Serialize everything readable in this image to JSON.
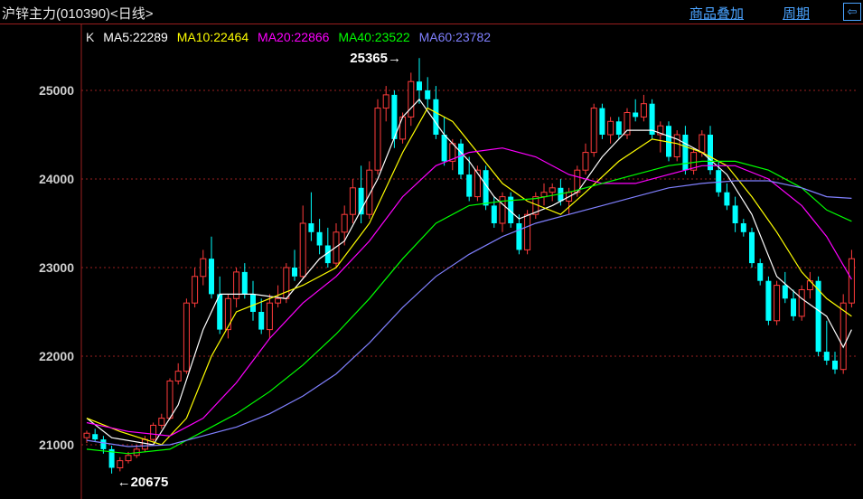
{
  "header": {
    "title": "沪锌主力(010390)<日线>",
    "overlay_link": "商品叠加",
    "period_link": "周期",
    "exit_icon": "exit-icon"
  },
  "colors": {
    "up": "#ff3b3b",
    "down": "#00ffff",
    "grid": "#9a1f1f",
    "axis_text": "#d0d0d0"
  },
  "legend": {
    "k_label": "K",
    "ma5": {
      "label": "MA5:22289",
      "color": "#ffffff"
    },
    "ma10": {
      "label": "MA10:22464",
      "color": "#ffff00"
    },
    "ma20": {
      "label": "MA20:22866",
      "color": "#ff00ff"
    },
    "ma40": {
      "label": "MA40:23522",
      "color": "#00ff00"
    },
    "ma60": {
      "label": "MA60:23782",
      "color": "#8080ff"
    }
  },
  "chart_data": {
    "type": "candlestick",
    "y_ticks": [
      "25000",
      "24000",
      "23000",
      "22000",
      "21000"
    ],
    "ylim": [
      20500,
      25500
    ],
    "grid": "horizontal dotted",
    "annotations": [
      {
        "text": "25365",
        "index": 40,
        "value": 25365,
        "side": "left"
      },
      {
        "text": "20675",
        "index": 3,
        "value": 20675,
        "side": "right"
      }
    ],
    "candles": [
      [
        21080,
        21160,
        21020,
        21130
      ],
      [
        21120,
        21180,
        21040,
        21060
      ],
      [
        21060,
        21100,
        20900,
        20950
      ],
      [
        20950,
        20990,
        20675,
        20740
      ],
      [
        20740,
        20860,
        20700,
        20820
      ],
      [
        20820,
        20920,
        20790,
        20880
      ],
      [
        20880,
        21000,
        20850,
        20950
      ],
      [
        20950,
        21100,
        20920,
        21060
      ],
      [
        21060,
        21250,
        21030,
        21220
      ],
      [
        21220,
        21350,
        21180,
        21300
      ],
      [
        21300,
        21750,
        21280,
        21720
      ],
      [
        21720,
        21920,
        21680,
        21830
      ],
      [
        21830,
        22650,
        21800,
        22600
      ],
      [
        22600,
        23000,
        22550,
        22900
      ],
      [
        22900,
        23200,
        22800,
        23100
      ],
      [
        23100,
        23350,
        22650,
        22700
      ],
      [
        22700,
        22900,
        22250,
        22300
      ],
      [
        22300,
        22700,
        22200,
        22650
      ],
      [
        22650,
        23000,
        22550,
        22950
      ],
      [
        22950,
        23050,
        22650,
        22700
      ],
      [
        22700,
        22850,
        22400,
        22500
      ],
      [
        22500,
        22650,
        22250,
        22300
      ],
      [
        22300,
        22700,
        22200,
        22600
      ],
      [
        22600,
        22800,
        22550,
        22650
      ],
      [
        22650,
        23050,
        22600,
        23000
      ],
      [
        23000,
        23200,
        22850,
        22900
      ],
      [
        22900,
        23700,
        22880,
        23500
      ],
      [
        23500,
        23850,
        23300,
        23400
      ],
      [
        23400,
        23550,
        23150,
        23250
      ],
      [
        23250,
        23450,
        23000,
        23050
      ],
      [
        23050,
        23500,
        23000,
        23400
      ],
      [
        23400,
        23700,
        23250,
        23600
      ],
      [
        23600,
        24000,
        23500,
        23900
      ],
      [
        23900,
        24150,
        23500,
        23600
      ],
      [
        23600,
        24200,
        23550,
        24100
      ],
      [
        24100,
        24900,
        24050,
        24800
      ],
      [
        24800,
        25050,
        24650,
        24950
      ],
      [
        24950,
        25000,
        24350,
        24450
      ],
      [
        24450,
        24750,
        24400,
        24700
      ],
      [
        24700,
        25200,
        24600,
        25100
      ],
      [
        25100,
        25365,
        24850,
        25000
      ],
      [
        25000,
        25150,
        24800,
        24900
      ],
      [
        24900,
        25050,
        24450,
        24500
      ],
      [
        24500,
        24700,
        24150,
        24200
      ],
      [
        24200,
        24450,
        24100,
        24400
      ],
      [
        24400,
        24450,
        24000,
        24050
      ],
      [
        24050,
        24250,
        23750,
        23800
      ],
      [
        23800,
        24150,
        23750,
        24100
      ],
      [
        24100,
        24150,
        23650,
        23700
      ],
      [
        23700,
        23800,
        23450,
        23500
      ],
      [
        23500,
        23850,
        23400,
        23800
      ],
      [
        23800,
        23850,
        23450,
        23500
      ],
      [
        23500,
        23600,
        23150,
        23200
      ],
      [
        23200,
        23650,
        23150,
        23600
      ],
      [
        23600,
        23850,
        23550,
        23800
      ],
      [
        23800,
        23950,
        23700,
        23850
      ],
      [
        23850,
        23950,
        23750,
        23900
      ],
      [
        23900,
        24000,
        23700,
        23750
      ],
      [
        23750,
        23900,
        23600,
        23850
      ],
      [
        23850,
        24150,
        23800,
        24100
      ],
      [
        24100,
        24400,
        24050,
        24300
      ],
      [
        24300,
        24850,
        24250,
        24800
      ],
      [
        24800,
        24850,
        24450,
        24500
      ],
      [
        24500,
        24700,
        24400,
        24650
      ],
      [
        24650,
        24700,
        24450,
        24500
      ],
      [
        24500,
        24800,
        24450,
        24750
      ],
      [
        24750,
        24900,
        24650,
        24700
      ],
      [
        24700,
        24950,
        24650,
        24850
      ],
      [
        24850,
        24900,
        24450,
        24500
      ],
      [
        24500,
        24650,
        24300,
        24600
      ],
      [
        24600,
        24650,
        24200,
        24250
      ],
      [
        24250,
        24550,
        24200,
        24500
      ],
      [
        24500,
        24600,
        24050,
        24100
      ],
      [
        24100,
        24350,
        24050,
        24300
      ],
      [
        24300,
        24550,
        24250,
        24500
      ],
      [
        24500,
        24600,
        24050,
        24100
      ],
      [
        24100,
        24200,
        23800,
        23850
      ],
      [
        23850,
        23950,
        23650,
        23700
      ],
      [
        23700,
        23800,
        23400,
        23500
      ],
      [
        23500,
        23550,
        23350,
        23400
      ],
      [
        23400,
        23450,
        23000,
        23050
      ],
      [
        23050,
        23100,
        22800,
        22850
      ],
      [
        22850,
        22900,
        22350,
        22400
      ],
      [
        22400,
        22850,
        22350,
        22800
      ],
      [
        22800,
        22950,
        22600,
        22650
      ],
      [
        22650,
        22750,
        22400,
        22450
      ],
      [
        22450,
        22800,
        22400,
        22750
      ],
      [
        22750,
        22950,
        22650,
        22850
      ],
      [
        22850,
        22900,
        22000,
        22050
      ],
      [
        22050,
        22400,
        21900,
        21950
      ],
      [
        21950,
        22050,
        21800,
        21850
      ],
      [
        21850,
        22700,
        21800,
        22600
      ],
      [
        22600,
        23200,
        22550,
        23100
      ]
    ],
    "ma": {
      "MA5": [
        [
          0,
          21300
        ],
        [
          3,
          21080
        ],
        [
          8,
          21000
        ],
        [
          11,
          21450
        ],
        [
          14,
          22300
        ],
        [
          16,
          22700
        ],
        [
          20,
          22700
        ],
        [
          24,
          22650
        ],
        [
          28,
          23100
        ],
        [
          31,
          23300
        ],
        [
          35,
          24000
        ],
        [
          38,
          24700
        ],
        [
          40,
          24900
        ],
        [
          43,
          24500
        ],
        [
          46,
          24200
        ],
        [
          49,
          23800
        ],
        [
          52,
          23550
        ],
        [
          56,
          23700
        ],
        [
          59,
          23850
        ],
        [
          62,
          24250
        ],
        [
          65,
          24550
        ],
        [
          68,
          24550
        ],
        [
          71,
          24450
        ],
        [
          74,
          24300
        ],
        [
          77,
          24050
        ],
        [
          80,
          23600
        ],
        [
          83,
          22900
        ],
        [
          86,
          22650
        ],
        [
          89,
          22450
        ],
        [
          91,
          22100
        ],
        [
          92,
          22300
        ]
      ],
      "MA10": [
        [
          0,
          21300
        ],
        [
          4,
          21150
        ],
        [
          9,
          21000
        ],
        [
          12,
          21300
        ],
        [
          15,
          22000
        ],
        [
          18,
          22500
        ],
        [
          22,
          22650
        ],
        [
          26,
          22800
        ],
        [
          30,
          23000
        ],
        [
          34,
          23500
        ],
        [
          38,
          24300
        ],
        [
          41,
          24800
        ],
        [
          44,
          24650
        ],
        [
          47,
          24300
        ],
        [
          50,
          23950
        ],
        [
          53,
          23750
        ],
        [
          57,
          23600
        ],
        [
          60,
          23850
        ],
        [
          64,
          24200
        ],
        [
          68,
          24450
        ],
        [
          71,
          24400
        ],
        [
          74,
          24300
        ],
        [
          77,
          24150
        ],
        [
          80,
          23800
        ],
        [
          83,
          23400
        ],
        [
          86,
          22950
        ],
        [
          89,
          22650
        ],
        [
          92,
          22450
        ]
      ],
      "MA20": [
        [
          0,
          21250
        ],
        [
          5,
          21150
        ],
        [
          10,
          21100
        ],
        [
          14,
          21300
        ],
        [
          18,
          21700
        ],
        [
          22,
          22200
        ],
        [
          26,
          22600
        ],
        [
          30,
          22900
        ],
        [
          34,
          23300
        ],
        [
          38,
          23800
        ],
        [
          42,
          24150
        ],
        [
          46,
          24300
        ],
        [
          50,
          24350
        ],
        [
          54,
          24250
        ],
        [
          58,
          24050
        ],
        [
          62,
          23950
        ],
        [
          66,
          23950
        ],
        [
          70,
          24050
        ],
        [
          74,
          24150
        ],
        [
          78,
          24150
        ],
        [
          82,
          24000
        ],
        [
          86,
          23700
        ],
        [
          89,
          23350
        ],
        [
          92,
          22866
        ]
      ],
      "MA40": [
        [
          0,
          20950
        ],
        [
          5,
          20900
        ],
        [
          10,
          20950
        ],
        [
          14,
          21150
        ],
        [
          18,
          21350
        ],
        [
          22,
          21600
        ],
        [
          26,
          21900
        ],
        [
          30,
          22250
        ],
        [
          34,
          22650
        ],
        [
          38,
          23100
        ],
        [
          42,
          23500
        ],
        [
          46,
          23700
        ],
        [
          50,
          23750
        ],
        [
          54,
          23780
        ],
        [
          58,
          23850
        ],
        [
          62,
          23950
        ],
        [
          66,
          24050
        ],
        [
          70,
          24150
        ],
        [
          74,
          24200
        ],
        [
          78,
          24200
        ],
        [
          82,
          24100
        ],
        [
          86,
          23900
        ],
        [
          89,
          23650
        ],
        [
          92,
          23522
        ]
      ],
      "MA60": [
        [
          0,
          21050
        ],
        [
          5,
          20980
        ],
        [
          10,
          21000
        ],
        [
          14,
          21100
        ],
        [
          18,
          21200
        ],
        [
          22,
          21350
        ],
        [
          26,
          21550
        ],
        [
          30,
          21800
        ],
        [
          34,
          22150
        ],
        [
          38,
          22550
        ],
        [
          42,
          22900
        ],
        [
          46,
          23150
        ],
        [
          50,
          23350
        ],
        [
          54,
          23500
        ],
        [
          58,
          23600
        ],
        [
          62,
          23700
        ],
        [
          66,
          23800
        ],
        [
          70,
          23900
        ],
        [
          74,
          23950
        ],
        [
          78,
          23980
        ],
        [
          82,
          23980
        ],
        [
          86,
          23900
        ],
        [
          89,
          23800
        ],
        [
          92,
          23782
        ]
      ]
    }
  }
}
